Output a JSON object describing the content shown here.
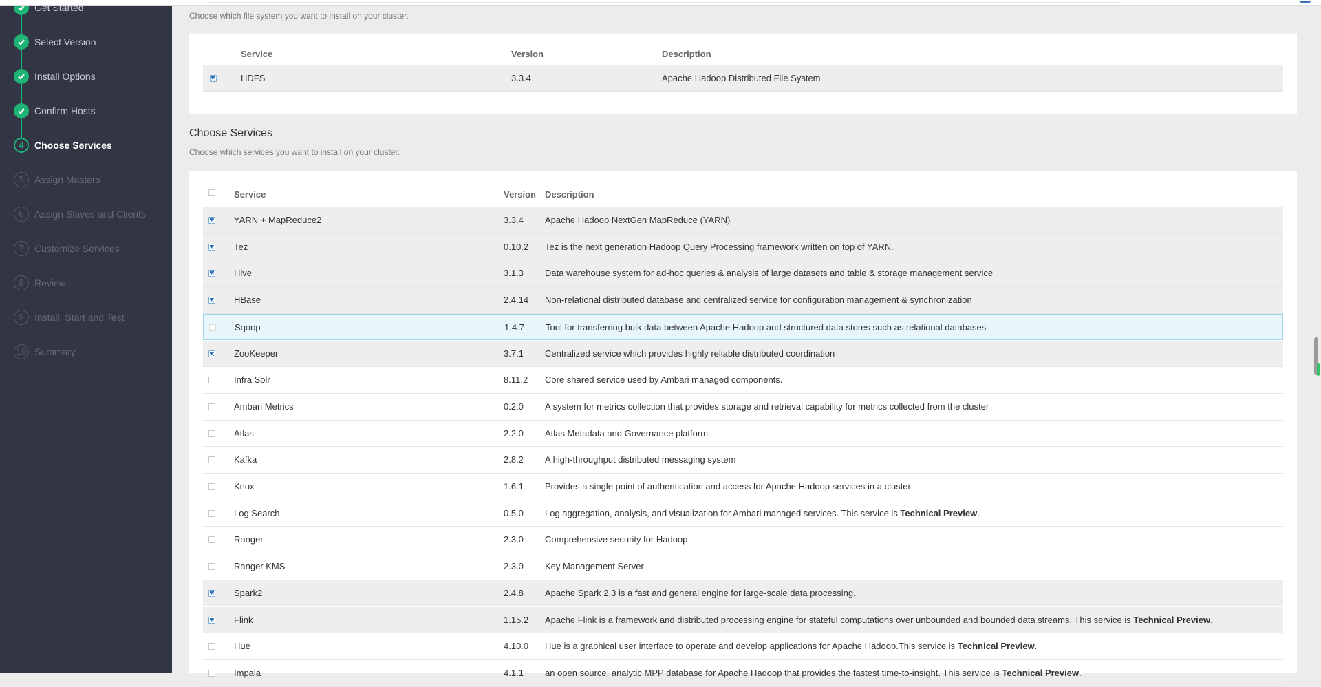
{
  "steps": [
    {
      "num": "1",
      "label": "Get Started",
      "state": "done"
    },
    {
      "num": "2",
      "label": "Select Version",
      "state": "done"
    },
    {
      "num": "3",
      "label": "Install Options",
      "state": "done"
    },
    {
      "num": "4",
      "label": "Confirm Hosts",
      "state": "done"
    },
    {
      "num": "4",
      "label": "Choose Services",
      "state": "active"
    },
    {
      "num": "5",
      "label": "Assign Masters",
      "state": "pending"
    },
    {
      "num": "6",
      "label": "Assign Slaves and Clients",
      "state": "pending"
    },
    {
      "num": "7",
      "label": "Customize Services",
      "state": "pending"
    },
    {
      "num": "8",
      "label": "Review",
      "state": "pending"
    },
    {
      "num": "9",
      "label": "Install, Start and Test",
      "state": "pending"
    },
    {
      "num": "10",
      "label": "Summary",
      "state": "pending"
    }
  ],
  "filesystem": {
    "subtitle": "Choose which file system you want to install on your cluster.",
    "headers": {
      "service": "Service",
      "version": "Version",
      "description": "Description"
    },
    "rows": [
      {
        "checked": true,
        "service": "HDFS",
        "version": "3.3.4",
        "description": "Apache Hadoop Distributed File System"
      }
    ]
  },
  "services": {
    "title": "Choose Services",
    "subtitle": "Choose which services you want to install on your cluster.",
    "headers": {
      "service": "Service",
      "version": "Version",
      "description": "Description"
    },
    "rows": [
      {
        "checked": true,
        "service": "YARN + MapReduce2",
        "version": "3.3.4",
        "description": "Apache Hadoop NextGen MapReduce (YARN)",
        "tp_suffix": ""
      },
      {
        "checked": true,
        "service": "Tez",
        "version": "0.10.2",
        "description": "Tez is the next generation Hadoop Query Processing framework written on top of YARN.",
        "tp_suffix": ""
      },
      {
        "checked": true,
        "service": "Hive",
        "version": "3.1.3",
        "description": "Data warehouse system for ad-hoc queries & analysis of large datasets and table & storage management service",
        "tp_suffix": ""
      },
      {
        "checked": true,
        "service": "HBase",
        "version": "2.4.14",
        "description": "Non-relational distributed database and centralized service for configuration management & synchronization",
        "tp_suffix": ""
      },
      {
        "checked": false,
        "highlight": true,
        "service": "Sqoop",
        "version": "1.4.7",
        "description": "Tool for transferring bulk data between Apache Hadoop and structured data stores such as relational databases",
        "tp_suffix": ""
      },
      {
        "checked": true,
        "service": "ZooKeeper",
        "version": "3.7.1",
        "description": "Centralized service which provides highly reliable distributed coordination",
        "tp_suffix": ""
      },
      {
        "checked": false,
        "service": "Infra Solr",
        "version": "8.11.2",
        "description": "Core shared service used by Ambari managed components.",
        "tp_suffix": ""
      },
      {
        "checked": false,
        "service": "Ambari Metrics",
        "version": "0.2.0",
        "description": "A system for metrics collection that provides storage and retrieval capability for metrics collected from the cluster",
        "tp_suffix": ""
      },
      {
        "checked": false,
        "service": "Atlas",
        "version": "2.2.0",
        "description": "Atlas Metadata and Governance platform",
        "tp_suffix": ""
      },
      {
        "checked": false,
        "service": "Kafka",
        "version": "2.8.2",
        "description": "A high-throughput distributed messaging system",
        "tp_suffix": ""
      },
      {
        "checked": false,
        "service": "Knox",
        "version": "1.6.1",
        "description": "Provides a single point of authentication and access for Apache Hadoop services in a cluster",
        "tp_suffix": ""
      },
      {
        "checked": false,
        "service": "Log Search",
        "version": "0.5.0",
        "description": "Log aggregation, analysis, and visualization for Ambari managed services. This service is ",
        "tp_suffix": "Technical Preview",
        "tp_end": "."
      },
      {
        "checked": false,
        "service": "Ranger",
        "version": "2.3.0",
        "description": "Comprehensive security for Hadoop",
        "tp_suffix": ""
      },
      {
        "checked": false,
        "service": "Ranger KMS",
        "version": "2.3.0",
        "description": "Key Management Server",
        "tp_suffix": ""
      },
      {
        "checked": true,
        "service": "Spark2",
        "version": "2.4.8",
        "description": "Apache Spark 2.3 is a fast and general engine for large-scale data processing.",
        "tp_suffix": ""
      },
      {
        "checked": true,
        "service": "Flink",
        "version": "1.15.2",
        "description": "Apache Flink is a framework and distributed processing engine for stateful computations over unbounded and bounded data streams. This service is ",
        "tp_suffix": "Technical Preview",
        "tp_end": "."
      },
      {
        "checked": false,
        "service": "Hue",
        "version": "4.10.0",
        "description": "Hue is a graphical user interface to operate and develop applications for Apache Hadoop.This service is ",
        "tp_suffix": "Technical Preview",
        "tp_end": "."
      },
      {
        "checked": false,
        "service": "Impala",
        "version": "4.1.1",
        "description": "an open source, analytic MPP database for Apache Hadoop that provides the fastest time-to-insight. This service is ",
        "tp_suffix": "Technical Preview",
        "tp_end": "."
      }
    ]
  }
}
